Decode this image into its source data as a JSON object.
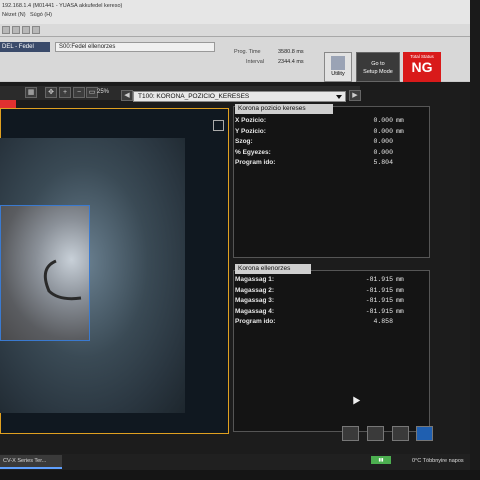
{
  "titlebar": {
    "line1": "192.168.1.4 (M01441 - YUASA akkufedel kereso)",
    "menu": [
      "Nézet (N)",
      "Súgó (H)"
    ]
  },
  "program": {
    "program_label": "DEL - Fedel",
    "scene_label": "S00:Fedel ellenorzes"
  },
  "timing": {
    "prog_time_label": "Prog. Time",
    "prog_time_value": "3580.8 ms",
    "interval_label": "Interval",
    "interval_value": "2344.4 ms"
  },
  "buttons": {
    "utility": "Utility",
    "setup_line1": "Go to",
    "setup_line2": "Setup Mode"
  },
  "total_status": {
    "label": "Total Status",
    "value": "NG"
  },
  "image_toolbar": {
    "zoom": "25%",
    "tool_selected": "T100: KORONA_POZICIO_KERESES"
  },
  "panel1": {
    "title": "Korona pozicio kereses",
    "rows": [
      {
        "label": "X Pozicio:",
        "value": "0.000",
        "unit": "mm"
      },
      {
        "label": "Y Pozicio:",
        "value": "0.000",
        "unit": "mm"
      },
      {
        "label": "Szog:",
        "value": "0.000",
        "unit": ""
      },
      {
        "label": "% Egyezes:",
        "value": "0.000",
        "unit": ""
      },
      {
        "label": "Program ido:",
        "value": "5.804",
        "unit": ""
      }
    ]
  },
  "panel2": {
    "title": "Korona ellenorzes",
    "rows": [
      {
        "label": "Magassag 1:",
        "value": "-81.915",
        "unit": "mm"
      },
      {
        "label": "Magassag 2:",
        "value": "-81.915",
        "unit": "mm"
      },
      {
        "label": "Magassag 3:",
        "value": "-81.915",
        "unit": "mm"
      },
      {
        "label": "Magassag 4:",
        "value": "-81.915",
        "unit": "mm"
      },
      {
        "label": "Program ido:",
        "value": "4.858",
        "unit": ""
      }
    ]
  },
  "taskbar": {
    "app_label": "CV-X Series Ter...",
    "weather": "0°C  Többnyire napos"
  },
  "colors": {
    "ng_red": "#d91a1a",
    "image_border": "#e0a020",
    "roi_blue": "#3a7ad0"
  }
}
